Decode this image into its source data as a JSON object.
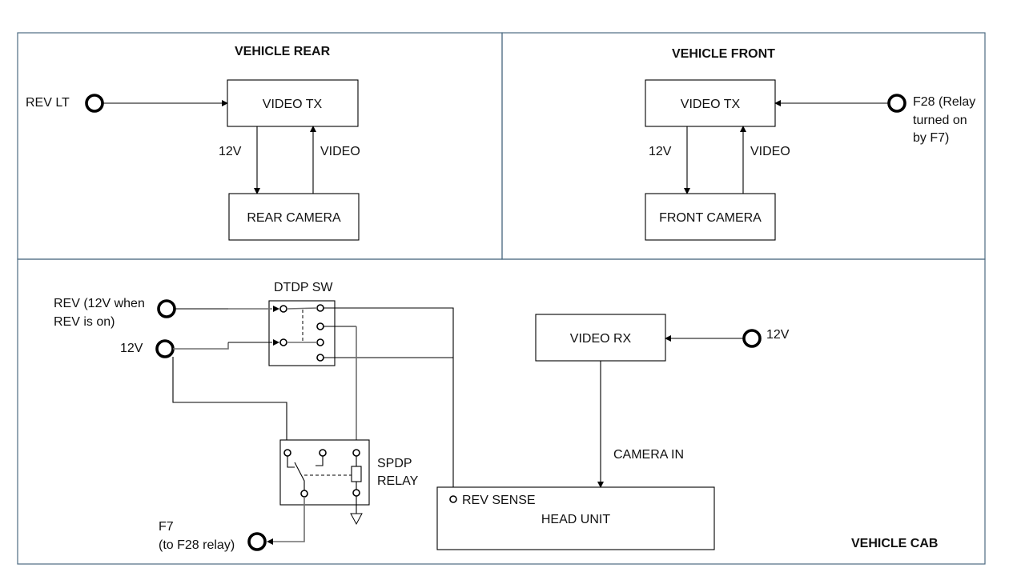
{
  "panels": {
    "rear": {
      "title": "VEHICLE REAR"
    },
    "front": {
      "title": "VEHICLE FRONT"
    },
    "cab": {
      "title": "VEHICLE CAB"
    }
  },
  "rear": {
    "input_label": "REV LT",
    "tx_label": "VIDEO TX",
    "camera_label": "REAR CAMERA",
    "power_label": "12V",
    "video_label": "VIDEO"
  },
  "front": {
    "input_label_lines": [
      "F28 (Relay",
      "turned on",
      "by F7)"
    ],
    "tx_label": "VIDEO TX",
    "camera_label": "FRONT CAMERA",
    "power_label": "12V",
    "video_label": "VIDEO"
  },
  "cab": {
    "rev_input_lines": [
      "REV (12V when",
      "REV is on)"
    ],
    "power_input_label": "12V",
    "switch_label": "DTDP SW",
    "relay_label_lines": [
      "SPDP",
      "RELAY"
    ],
    "f7_label_lines": [
      "F7",
      "(to F28 relay)"
    ],
    "rx_label": "VIDEO RX",
    "rx_power_label": "12V",
    "camera_in_label": "CAMERA IN",
    "rev_sense_label": "REV SENSE",
    "head_unit_label": "HEAD UNIT"
  }
}
